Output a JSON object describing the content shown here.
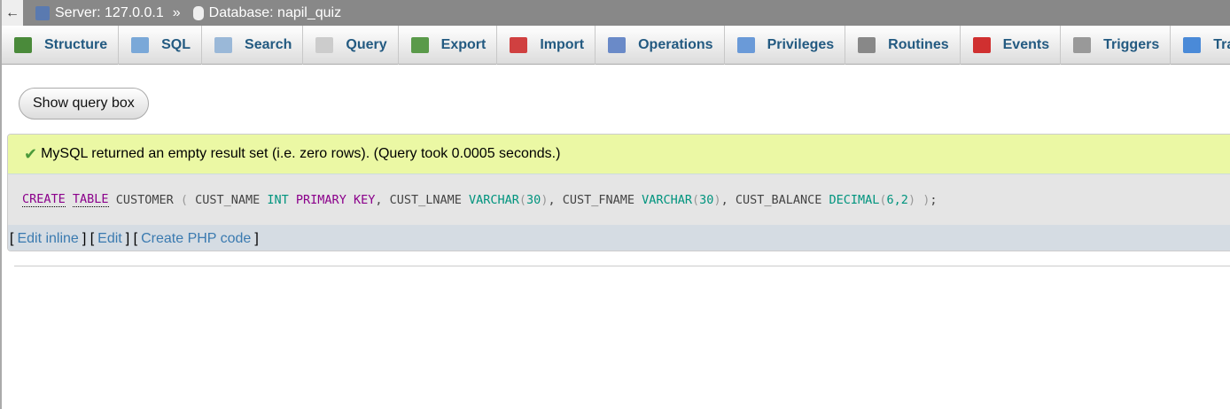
{
  "topbar": {
    "back": "←",
    "server": "Server: 127.0.0.1",
    "sep": "»",
    "database": "Database: napil_quiz"
  },
  "tabs": [
    {
      "label": "Structure",
      "icon": "structure-icon",
      "color": "#4a8a3a"
    },
    {
      "label": "SQL",
      "icon": "sql-icon",
      "color": "#7aa8d8"
    },
    {
      "label": "Search",
      "icon": "search-icon",
      "color": "#9ab8d8"
    },
    {
      "label": "Query",
      "icon": "query-icon",
      "color": "#ccc"
    },
    {
      "label": "Export",
      "icon": "export-icon",
      "color": "#5a9a4a"
    },
    {
      "label": "Import",
      "icon": "import-icon",
      "color": "#d04040"
    },
    {
      "label": "Operations",
      "icon": "wrench-icon",
      "color": "#6a8ac8"
    },
    {
      "label": "Privileges",
      "icon": "privileges-icon",
      "color": "#6a9ad8"
    },
    {
      "label": "Routines",
      "icon": "routines-icon",
      "color": "#888"
    },
    {
      "label": "Events",
      "icon": "clock-icon",
      "color": "#d03030"
    },
    {
      "label": "Triggers",
      "icon": "triggers-icon",
      "color": "#999"
    },
    {
      "label": "Tracking",
      "icon": "eye-icon",
      "color": "#4a8ad8"
    }
  ],
  "show_query_box": "Show query box",
  "message": "MySQL returned an empty result set (i.e. zero rows). (Query took 0.0005 seconds.)",
  "sql_tokens": [
    [
      "CREATE",
      "kwu"
    ],
    [
      " ",
      ""
    ],
    [
      "TABLE",
      "kwu"
    ],
    [
      " CUSTOMER ",
      ""
    ],
    [
      "(",
      "pu"
    ],
    [
      " CUST_NAME ",
      ""
    ],
    [
      "INT",
      "ty"
    ],
    [
      " ",
      ""
    ],
    [
      "PRIMARY KEY",
      "kw"
    ],
    [
      ", CUST_LNAME ",
      ""
    ],
    [
      "VARCHAR",
      "ty"
    ],
    [
      "(",
      "pu"
    ],
    [
      "30",
      "ty"
    ],
    [
      ")",
      "pu"
    ],
    [
      ", CUST_FNAME ",
      ""
    ],
    [
      "VARCHAR",
      "ty"
    ],
    [
      "(",
      "pu"
    ],
    [
      "30",
      "ty"
    ],
    [
      ")",
      "pu"
    ],
    [
      ", CUST_BALANCE ",
      ""
    ],
    [
      "DECIMAL",
      "ty"
    ],
    [
      "(",
      "pu"
    ],
    [
      "6,2",
      "ty"
    ],
    [
      ")",
      "pu"
    ],
    [
      " ",
      ""
    ],
    [
      ")",
      "pu"
    ],
    [
      ";",
      ""
    ]
  ],
  "links": [
    "Edit inline",
    "Edit",
    "Create PHP code"
  ]
}
